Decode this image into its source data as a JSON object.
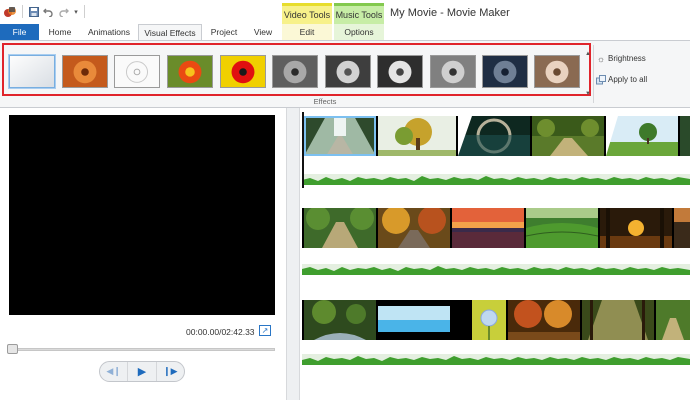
{
  "window": {
    "title": "My Movie - Movie Maker",
    "context_headers": {
      "video_tools": "Video Tools",
      "music_tools": "Music Tools"
    }
  },
  "quick_access": {
    "icons": [
      "movie-maker-logo-icon",
      "save-icon",
      "undo-icon",
      "redo-icon",
      "customize-toolbar-icon"
    ],
    "more_glyph": "▾"
  },
  "tabs": [
    {
      "label": "File",
      "active": false
    },
    {
      "label": "Home",
      "active": false
    },
    {
      "label": "Animations",
      "active": false
    },
    {
      "label": "Visual Effects",
      "active": true
    },
    {
      "label": "Project",
      "active": false
    },
    {
      "label": "View",
      "active": false
    },
    {
      "label": "Edit",
      "active": false
    },
    {
      "label": "Options",
      "active": false
    }
  ],
  "ribbon": {
    "group_label": "Effects",
    "effects": [
      {
        "name": "No effect",
        "selected": true
      },
      {
        "name": "Sepia",
        "selected": false
      },
      {
        "name": "Edge detection",
        "selected": false
      },
      {
        "name": "Warm",
        "selected": false
      },
      {
        "name": "Posterize",
        "selected": false
      },
      {
        "name": "Black and white",
        "selected": false
      },
      {
        "name": "Black and white orange filter",
        "selected": false
      },
      {
        "name": "Black and white red filter",
        "selected": false
      },
      {
        "name": "Black and white yellow filter",
        "selected": false
      },
      {
        "name": "Cinematic",
        "selected": false
      },
      {
        "name": "Threshold",
        "selected": false
      }
    ],
    "brightness_label": "Brightness",
    "apply_all_label": "Apply to all",
    "highlight_color": "#e0242b",
    "scroll_up_glyph": "▲",
    "scroll_down_glyph": "▼"
  },
  "preview": {
    "time_display": "00:00.00/02:42.33",
    "seek_position": 0.0,
    "controls": [
      {
        "name": "previous-frame-button",
        "glyph": "◀❙"
      },
      {
        "name": "play-button",
        "glyph": "▶"
      },
      {
        "name": "next-frame-button",
        "glyph": "❙▶"
      }
    ],
    "fullscreen_glyph": "↗"
  },
  "storyboard": {
    "rows": [
      {
        "clips": [
          "forest path",
          "autumn tree",
          "bridge reflection",
          "park path",
          "tree field",
          "pine forest"
        ],
        "selected_clip": 0
      },
      {
        "clips": [
          "forest road",
          "autumn road",
          "sunset lake",
          "tea hills",
          "sunset forest",
          "sunset road"
        ]
      },
      {
        "clips": [
          "forest stream",
          "blue flowers",
          "bubble flower",
          "autumn trees",
          "forest light",
          "forest path"
        ]
      }
    ]
  },
  "colors": {
    "accent_blue": "#1e6bbd",
    "video_tools": "#f7f18a",
    "music_tools": "#c7eda6",
    "waveform": "#3f9e2e"
  }
}
